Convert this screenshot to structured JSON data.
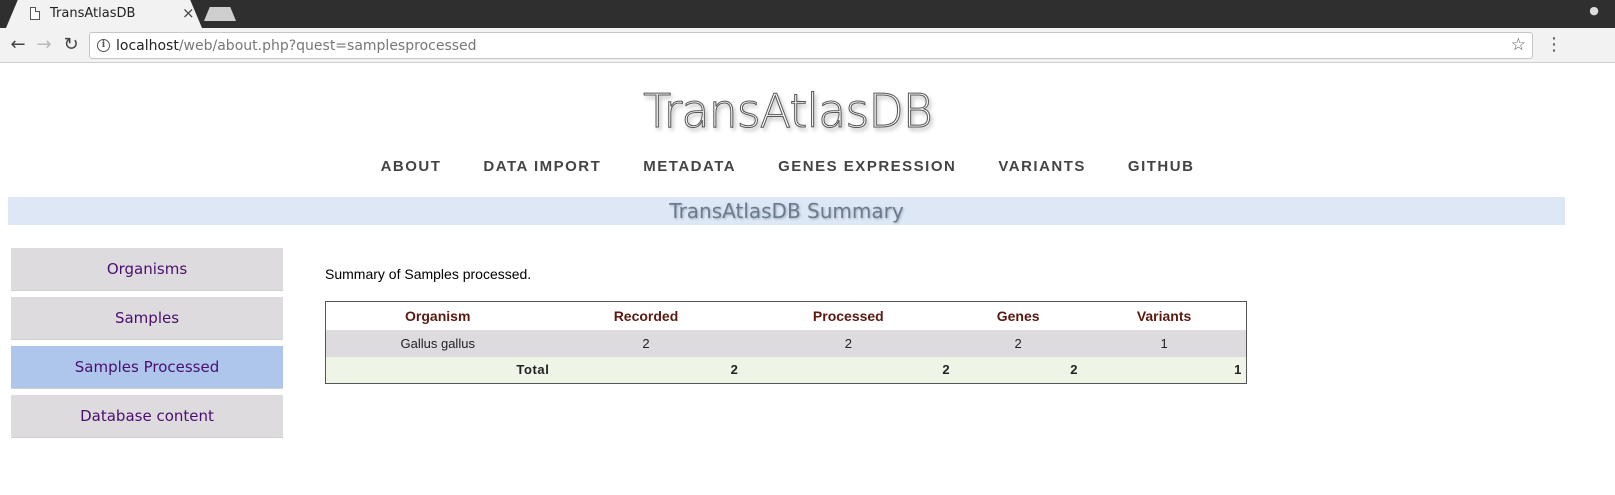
{
  "browser": {
    "tab_title": "TransAtlasDB",
    "tab_close": "×",
    "url_host": "localhost",
    "url_path": "/web/about.php?quest=samplesprocessed"
  },
  "site": {
    "title": "TransAtlasDB",
    "nav": [
      "ABOUT",
      "DATA IMPORT",
      "METADATA",
      "GENES EXPRESSION",
      "VARIANTS",
      "GITHUB"
    ],
    "summary_title": "TransAtlasDB Summary"
  },
  "sidebar": {
    "items": [
      "Organisms",
      "Samples",
      "Samples Processed",
      "Database content"
    ],
    "active": "Samples Processed"
  },
  "content": {
    "intro": "Summary of Samples processed.",
    "table": {
      "headers": [
        "Organism",
        "Recorded",
        "Processed",
        "Genes",
        "Variants"
      ],
      "rows": [
        [
          "Gallus gallus",
          "2",
          "2",
          "2",
          "1"
        ]
      ],
      "total": [
        "Total",
        "2",
        "2",
        "2",
        "1"
      ]
    }
  },
  "colors": {
    "sidebar_active": "#aec6ec",
    "sidebar_inactive": "#dedbdf",
    "sidebar_text": "#4a0f6e",
    "header_text": "#5a1a10",
    "summary_bar": "#dde7f5",
    "total_row": "#eef5e6"
  }
}
